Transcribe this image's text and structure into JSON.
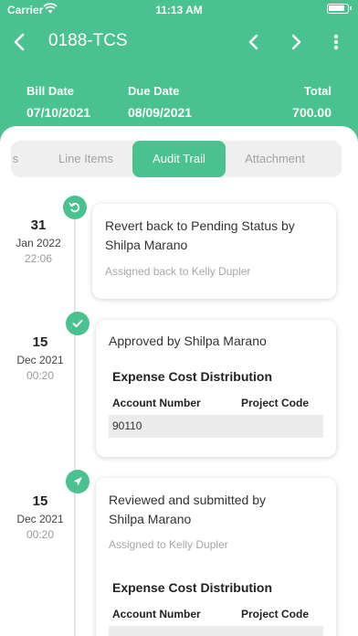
{
  "status_bar": {
    "carrier": "Carrier",
    "time": "11:13 AM"
  },
  "nav": {
    "title": "0188-TCS"
  },
  "summary": {
    "bill_date_label": "Bill Date",
    "bill_date": "07/10/2021",
    "due_date_label": "Due Date",
    "due_date": "08/09/2021",
    "total_label": "Total",
    "total": "700.00"
  },
  "tabs": [
    {
      "label": "s"
    },
    {
      "label": "Line Items"
    },
    {
      "label": "Audit Trail",
      "active": true
    },
    {
      "label": "Attachment"
    }
  ],
  "audit_trail": [
    {
      "day": "31",
      "month_year": "Jan 2022",
      "time": "22:06",
      "icon": "revert-icon",
      "title_line1": "Revert back to Pending Status by",
      "title_line2": "Shilpa Marano",
      "subtitle": "Assigned back to Kelly Dupler"
    },
    {
      "day": "15",
      "month_year": "Dec 2021",
      "time": "00:20",
      "icon": "check-icon",
      "title_line1": "Approved by  Shilpa Marano",
      "distribution_title": "Expense Cost Distribution",
      "col_account": "Account Number",
      "col_project": "Project Code",
      "account_value": "90110"
    },
    {
      "day": "15",
      "month_year": "Dec 2021",
      "time": "00:20",
      "icon": "send-icon",
      "title_line1": "Reviewed and submitted by",
      "title_line2": "Shilpa Marano",
      "subtitle": "Assigned to Kelly Dupler",
      "distribution_title": "Expense Cost Distribution",
      "col_account": "Account Number",
      "col_project": "Project Code"
    }
  ],
  "colors": {
    "accent": "#4ac28f",
    "timeline": "#e6e6e6"
  }
}
